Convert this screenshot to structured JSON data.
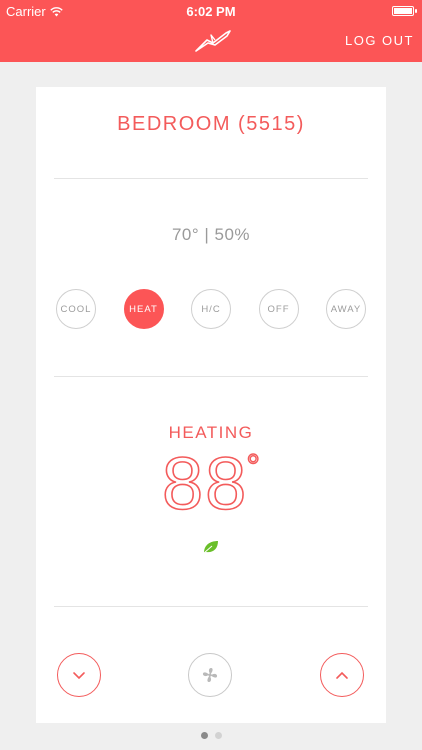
{
  "status_bar": {
    "carrier": "Carrier",
    "time": "6:02 PM"
  },
  "header": {
    "logo_icon": "bird-logo-icon",
    "logout_label": "LOG OUT"
  },
  "thermostat": {
    "room": "BEDROOM (5515)",
    "reading": "70° | 50%",
    "modes": [
      {
        "label": "COOL",
        "active": false
      },
      {
        "label": "HEAT",
        "active": true
      },
      {
        "label": "H/C",
        "active": false
      },
      {
        "label": "OFF",
        "active": false
      },
      {
        "label": "AWAY",
        "active": false
      }
    ],
    "state": "HEATING",
    "setpoint": "88",
    "setpoint_unit": "°",
    "eco_icon": "leaf-icon"
  },
  "controls": {
    "down_icon": "chevron-down-icon",
    "fan_icon": "fan-icon",
    "up_icon": "chevron-up-icon"
  },
  "pager": {
    "total_pages": 2,
    "current_page": 1
  },
  "colors": {
    "accent": "#fc5556",
    "eco": "#6abf2a"
  }
}
